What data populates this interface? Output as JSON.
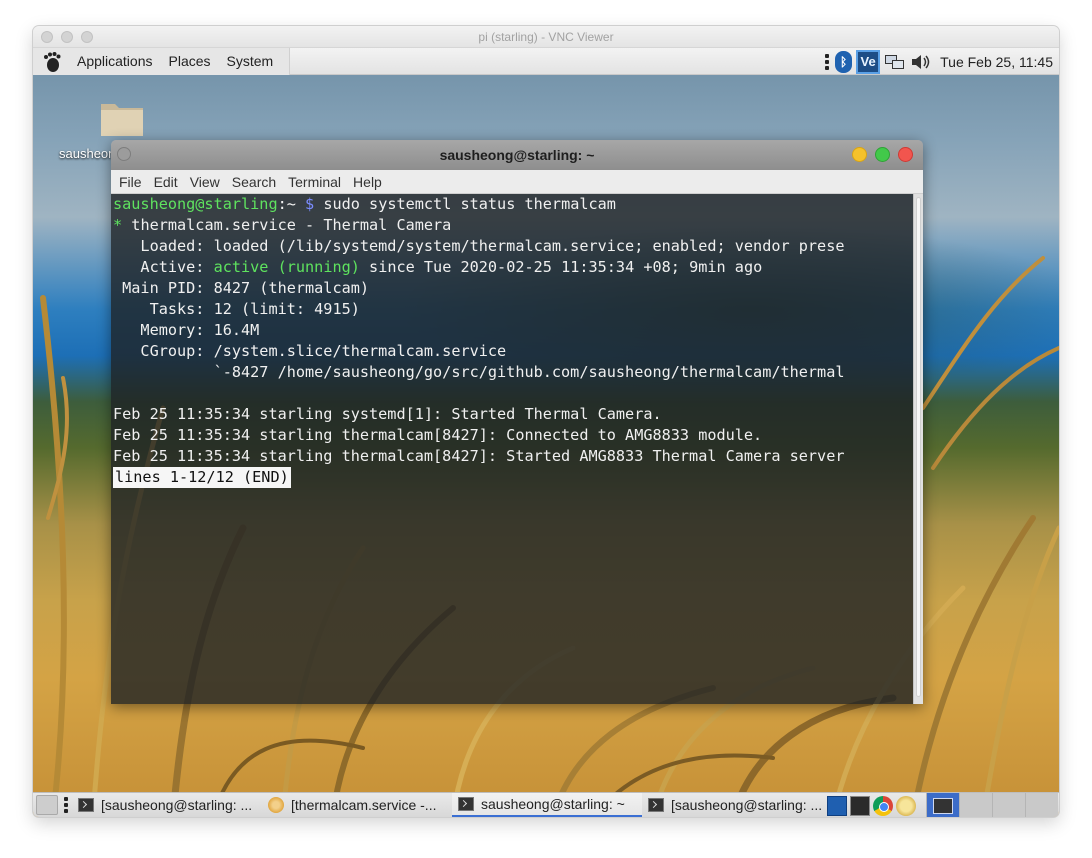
{
  "vnc": {
    "title": "pi (starling) - VNC Viewer"
  },
  "top_panel": {
    "menus": [
      "Applications",
      "Places",
      "System"
    ],
    "clock": "Tue Feb 25, 11:45",
    "vnc_icon_text": "Ve",
    "bluetooth_glyph": "ᛒ"
  },
  "desktop": {
    "folder_label": "sausheong"
  },
  "terminal": {
    "title": "sausheong@starling: ~",
    "menu": [
      "File",
      "Edit",
      "View",
      "Search",
      "Terminal",
      "Help"
    ],
    "prompt_user": "sausheong@starling",
    "prompt_sep": ":~ ",
    "prompt_dollar": "$",
    "command": " sudo systemctl status thermalcam",
    "service_bullet": "*",
    "service_line": " thermalcam.service - Thermal Camera",
    "loaded_line": "   Loaded: loaded (/lib/systemd/system/thermalcam.service; enabled; vendor prese",
    "active_label": "   Active: ",
    "active_state": "active (running)",
    "active_rest": " since Tue 2020-02-25 11:35:34 +08; 9min ago",
    "mainpid_line": " Main PID: 8427 (thermalcam)",
    "tasks_line": "    Tasks: 12 (limit: 4915)",
    "memory_line": "   Memory: 16.4M",
    "cgroup_line": "   CGroup: /system.slice/thermalcam.service",
    "cgroup_child": "           `-8427 /home/sausheong/go/src/github.com/sausheong/thermalcam/thermal",
    "blank": "",
    "log_lines": [
      "Feb 25 11:35:34 starling systemd[1]: Started Thermal Camera.",
      "Feb 25 11:35:34 starling thermalcam[8427]: Connected to AMG8833 module.",
      "Feb 25 11:35:34 starling thermalcam[8427]: Started AMG8833 Thermal Camera server"
    ],
    "pager": "lines 1-12/12 (END)"
  },
  "taskbar": {
    "tasks": [
      {
        "label": "[sausheong@starling: ...",
        "icon": "terminal-icon",
        "active": false
      },
      {
        "label": "[thermalcam.service -...",
        "icon": "document-icon",
        "active": false
      },
      {
        "label": "sausheong@starling: ~",
        "icon": "terminal-icon",
        "active": true
      },
      {
        "label": "[sausheong@starling: ...",
        "icon": "terminal-icon",
        "active": false
      }
    ],
    "launchers": [
      "text-editor-icon",
      "terminal-icon",
      "chromium-icon",
      "cat-icon"
    ]
  },
  "colors": {
    "prompt_green": "#5ee35e",
    "prompt_blue": "#7b8cff",
    "active_green": "#5ee35e",
    "taskbar_active": "#3b6fd3"
  }
}
